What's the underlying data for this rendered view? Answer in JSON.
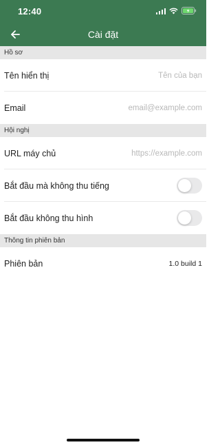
{
  "status_bar": {
    "time": "12:40",
    "icons": [
      "cellular-signal-icon",
      "wifi-icon",
      "battery-charging-icon"
    ]
  },
  "app_bar": {
    "back_icon": "arrow-left-icon",
    "title": "Cài đặt"
  },
  "sections": {
    "profile": {
      "header": "Hồ sơ",
      "display_name": {
        "label": "Tên hiển thị",
        "value": "",
        "placeholder": "Tên của bạn"
      },
      "email": {
        "label": "Email",
        "value": "",
        "placeholder": "email@example.com"
      }
    },
    "conference": {
      "header": "Hội nghị",
      "server_url": {
        "label": "URL máy chủ",
        "value": "",
        "placeholder": "https://example.com"
      },
      "start_muted": {
        "label": "Bắt đầu mà không thu tiếng",
        "on": false
      },
      "start_no_video": {
        "label": "Bắt đầu không thu hình",
        "on": false
      }
    },
    "version_info": {
      "header": "Thông tin phiên bản",
      "version": {
        "label": "Phiên bản",
        "value": "1.0 build 1"
      }
    }
  },
  "colors": {
    "brand": "#3c7a52",
    "section_bg": "#e6e6e6",
    "toggle_off": "#e9e9ea"
  }
}
